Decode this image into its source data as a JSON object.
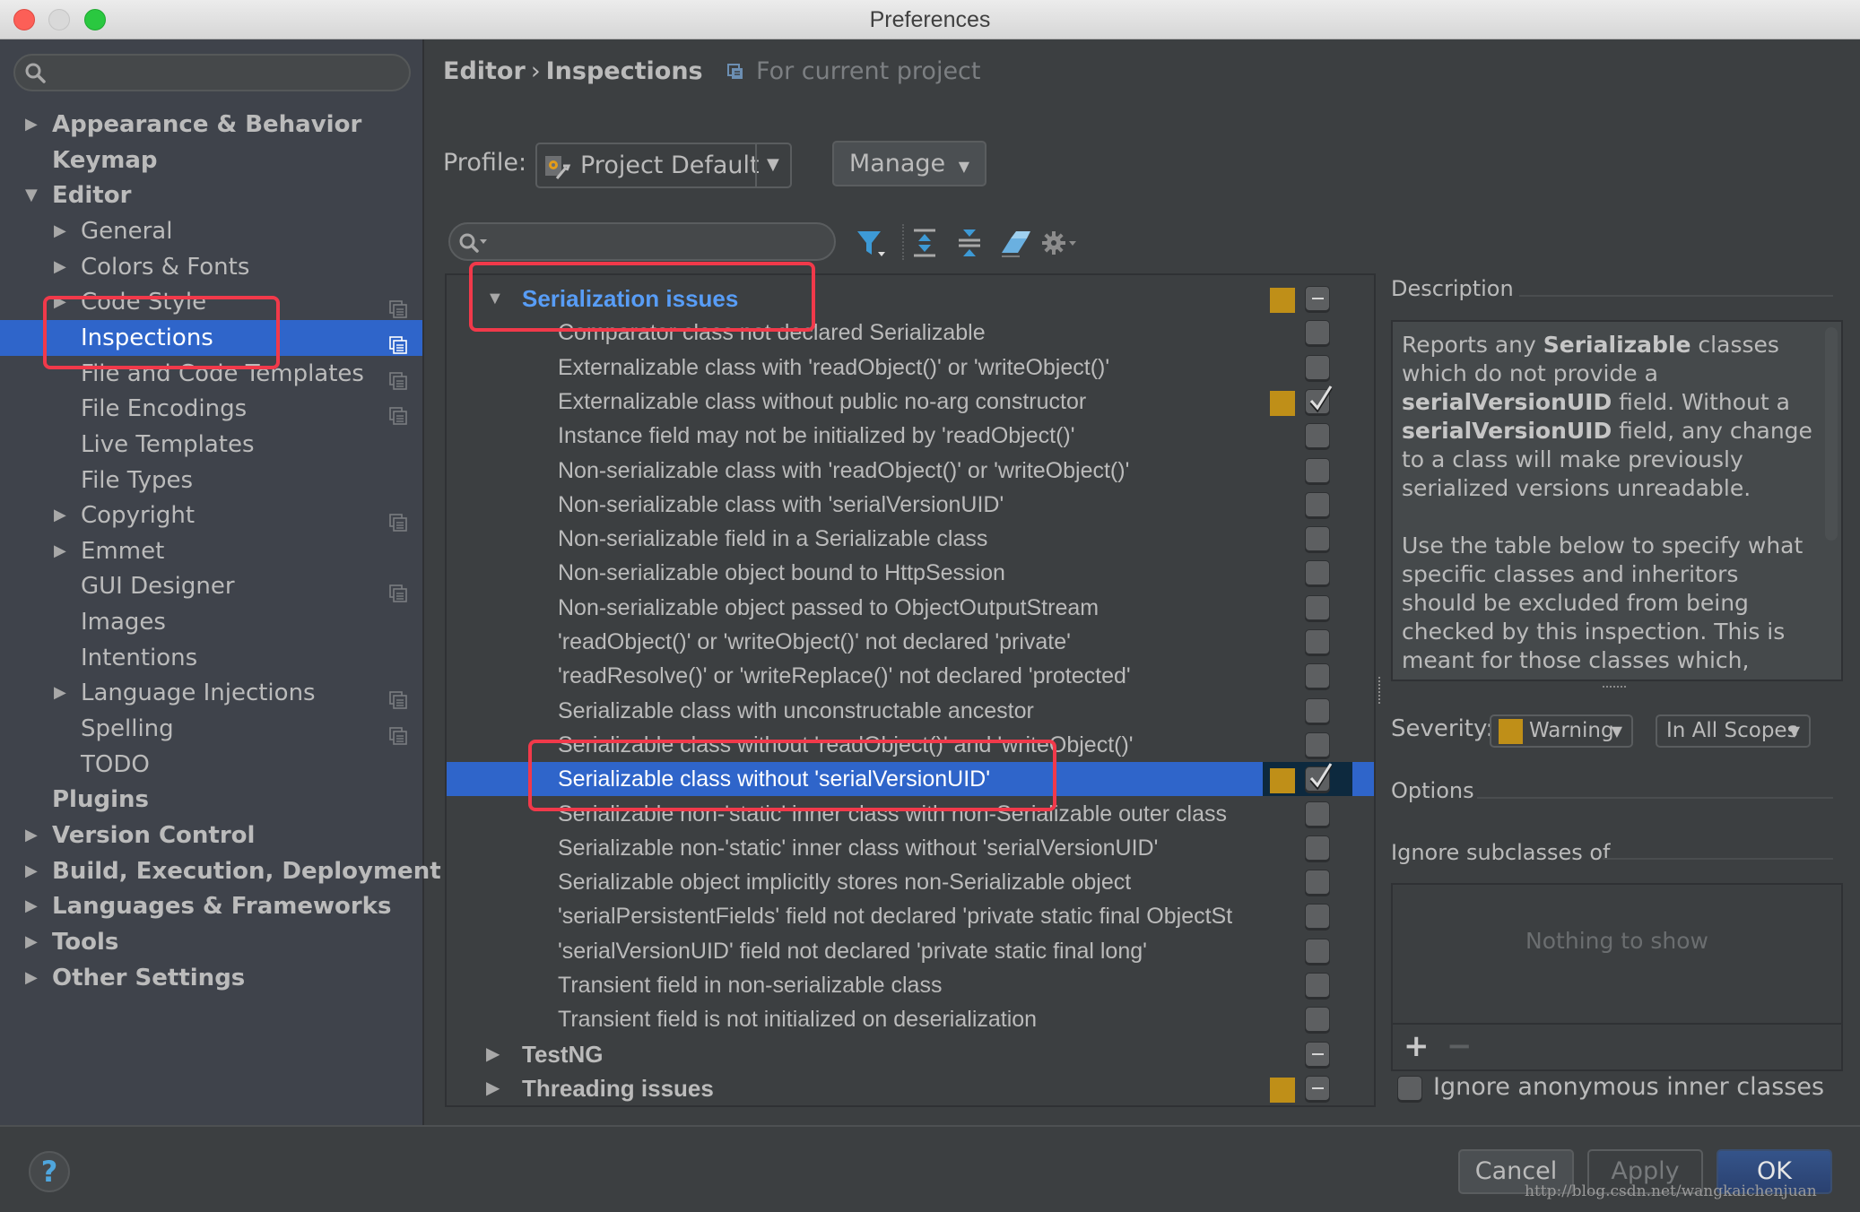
{
  "window": {
    "title": "Preferences"
  },
  "sidebar": {
    "search_placeholder": "",
    "items": [
      {
        "label": "Appearance & Behavior",
        "level": 0,
        "arrow": "collapsed",
        "project_icon": false
      },
      {
        "label": "Keymap",
        "level": 0,
        "arrow": "none",
        "project_icon": false
      },
      {
        "label": "Editor",
        "level": 0,
        "arrow": "expanded",
        "project_icon": false
      },
      {
        "label": "General",
        "level": 1,
        "arrow": "collapsed",
        "project_icon": false
      },
      {
        "label": "Colors & Fonts",
        "level": 1,
        "arrow": "collapsed",
        "project_icon": false
      },
      {
        "label": "Code Style",
        "level": 1,
        "arrow": "collapsed",
        "project_icon": true
      },
      {
        "label": "Inspections",
        "level": 1,
        "arrow": "none",
        "project_icon": true,
        "selected": true
      },
      {
        "label": "File and Code Templates",
        "level": 1,
        "arrow": "none",
        "project_icon": true
      },
      {
        "label": "File Encodings",
        "level": 1,
        "arrow": "none",
        "project_icon": true
      },
      {
        "label": "Live Templates",
        "level": 1,
        "arrow": "none",
        "project_icon": false
      },
      {
        "label": "File Types",
        "level": 1,
        "arrow": "none",
        "project_icon": false
      },
      {
        "label": "Copyright",
        "level": 1,
        "arrow": "collapsed",
        "project_icon": true
      },
      {
        "label": "Emmet",
        "level": 1,
        "arrow": "collapsed",
        "project_icon": false
      },
      {
        "label": "GUI Designer",
        "level": 1,
        "arrow": "none",
        "project_icon": true
      },
      {
        "label": "Images",
        "level": 1,
        "arrow": "none",
        "project_icon": false
      },
      {
        "label": "Intentions",
        "level": 1,
        "arrow": "none",
        "project_icon": false
      },
      {
        "label": "Language Injections",
        "level": 1,
        "arrow": "collapsed",
        "project_icon": true
      },
      {
        "label": "Spelling",
        "level": 1,
        "arrow": "none",
        "project_icon": true
      },
      {
        "label": "TODO",
        "level": 1,
        "arrow": "none",
        "project_icon": false
      },
      {
        "label": "Plugins",
        "level": 0,
        "arrow": "none",
        "project_icon": false
      },
      {
        "label": "Version Control",
        "level": 0,
        "arrow": "collapsed",
        "project_icon": false
      },
      {
        "label": "Build, Execution, Deployment",
        "level": 0,
        "arrow": "collapsed",
        "project_icon": false
      },
      {
        "label": "Languages & Frameworks",
        "level": 0,
        "arrow": "collapsed",
        "project_icon": false
      },
      {
        "label": "Tools",
        "level": 0,
        "arrow": "collapsed",
        "project_icon": false
      },
      {
        "label": "Other Settings",
        "level": 0,
        "arrow": "collapsed",
        "project_icon": false
      }
    ]
  },
  "header": {
    "breadcrumb_parent": "Editor",
    "breadcrumb_separator": "›",
    "breadcrumb_current": "Inspections",
    "scope_note": "For current project"
  },
  "profile": {
    "label": "Profile:",
    "value": "Project Default",
    "manage_label": "Manage"
  },
  "filter": {
    "search_value": "",
    "icons": [
      "filter-icon",
      "expand-all-icon",
      "collapse-all-icon",
      "reset-eraser-icon",
      "settings-gear-icon"
    ]
  },
  "inspections": {
    "rows": [
      {
        "type": "group",
        "label": "Serialization issues",
        "expanded": true,
        "severity_color": true,
        "state": "mixed"
      },
      {
        "type": "item",
        "label": "Comparator class not declared Serializable",
        "severity_color": false,
        "state": "unchecked"
      },
      {
        "type": "item",
        "label": "Externalizable class with 'readObject()' or 'writeObject()'",
        "severity_color": false,
        "state": "unchecked"
      },
      {
        "type": "item",
        "label": "Externalizable class without public no-arg constructor",
        "severity_color": true,
        "state": "checked"
      },
      {
        "type": "item",
        "label": "Instance field may not be initialized by 'readObject()'",
        "severity_color": false,
        "state": "unchecked"
      },
      {
        "type": "item",
        "label": "Non-serializable class with 'readObject()' or 'writeObject()'",
        "severity_color": false,
        "state": "unchecked"
      },
      {
        "type": "item",
        "label": "Non-serializable class with 'serialVersionUID'",
        "severity_color": false,
        "state": "unchecked"
      },
      {
        "type": "item",
        "label": "Non-serializable field in a Serializable class",
        "severity_color": false,
        "state": "unchecked"
      },
      {
        "type": "item",
        "label": "Non-serializable object bound to HttpSession",
        "severity_color": false,
        "state": "unchecked"
      },
      {
        "type": "item",
        "label": "Non-serializable object passed to ObjectOutputStream",
        "severity_color": false,
        "state": "unchecked"
      },
      {
        "type": "item",
        "label": "'readObject()' or 'writeObject()' not declared 'private'",
        "severity_color": false,
        "state": "unchecked"
      },
      {
        "type": "item",
        "label": "'readResolve()' or 'writeReplace()' not declared 'protected'",
        "severity_color": false,
        "state": "unchecked"
      },
      {
        "type": "item",
        "label": "Serializable class with unconstructable ancestor",
        "severity_color": false,
        "state": "unchecked"
      },
      {
        "type": "item",
        "label": "Serializable class without 'readObject()' and 'writeObject()'",
        "severity_color": false,
        "state": "unchecked"
      },
      {
        "type": "item",
        "label": "Serializable class without 'serialVersionUID'",
        "severity_color": true,
        "state": "checked",
        "selected": true
      },
      {
        "type": "item",
        "label": "Serializable non-'static' inner class with non-Serializable outer class",
        "severity_color": false,
        "state": "unchecked"
      },
      {
        "type": "item",
        "label": "Serializable non-'static' inner class without 'serialVersionUID'",
        "severity_color": false,
        "state": "unchecked"
      },
      {
        "type": "item",
        "label": "Serializable object implicitly stores non-Serializable object",
        "severity_color": false,
        "state": "unchecked"
      },
      {
        "type": "item",
        "label": "'serialPersistentFields' field not declared 'private static final ObjectSt",
        "severity_color": false,
        "state": "unchecked"
      },
      {
        "type": "item",
        "label": "'serialVersionUID' field not declared 'private static final long'",
        "severity_color": false,
        "state": "unchecked"
      },
      {
        "type": "item",
        "label": "Transient field in non-serializable class",
        "severity_color": false,
        "state": "unchecked"
      },
      {
        "type": "item",
        "label": "Transient field is not initialized on deserialization",
        "severity_color": false,
        "state": "unchecked"
      },
      {
        "type": "group",
        "label": "TestNG",
        "expanded": false,
        "severity_color": false,
        "state": "mixed"
      },
      {
        "type": "group",
        "label": "Threading issues",
        "expanded": false,
        "severity_color": true,
        "state": "mixed"
      }
    ]
  },
  "details": {
    "description_title": "Description",
    "description_paragraphs": [
      [
        {
          "text": "Reports any ",
          "bold": false
        },
        {
          "text": "Serializable",
          "bold": true
        },
        {
          "text": " classes which do not provide a ",
          "bold": false
        },
        {
          "text": "serialVersionUID",
          "bold": true
        },
        {
          "text": " field. Without a ",
          "bold": false
        },
        {
          "text": "serialVersionUID",
          "bold": true
        },
        {
          "text": " field, any change to a class will make previously serialized versions unreadable.",
          "bold": false
        }
      ],
      [
        {
          "text": "Use the table below to specify what specific classes and inheritors should be excluded from being checked by this inspection. This is meant for those classes which, although they inherit Serializable",
          "bold": false
        }
      ]
    ],
    "severity_label": "Severity:",
    "severity_value": "Warning",
    "severity_color": "#bf8f18",
    "scope_value": "In All Scopes",
    "options_title": "Options",
    "ignore_subclasses_title": "Ignore subclasses of",
    "ignore_subclasses_empty": "Nothing to show",
    "add_label": "+",
    "remove_label": "−",
    "ignore_anonymous_label": "Ignore anonymous inner classes",
    "ignore_anonymous_checked": false
  },
  "footer": {
    "help_label": "?",
    "cancel_label": "Cancel",
    "apply_label": "Apply",
    "ok_label": "OK",
    "watermark": "http://blog.csdn.net/wangkaichenjuan"
  },
  "colors": {
    "selection": "#2f65ca",
    "group_link": "#589df6",
    "warning": "#bf8f18",
    "annotation": "#f1394a"
  }
}
